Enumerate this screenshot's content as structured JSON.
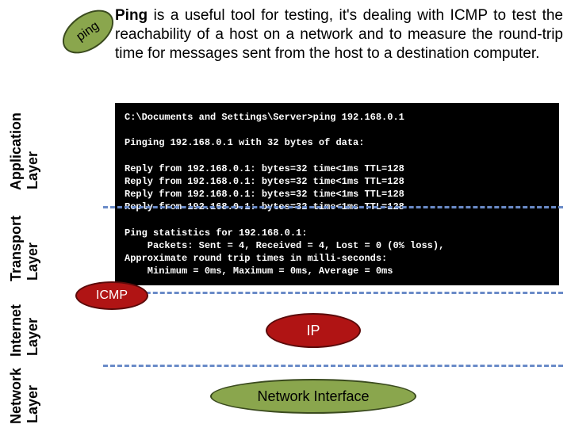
{
  "paragraph": {
    "bold": "Ping",
    "rest": " is a useful tool for testing, it's dealing with ICMP to test the reachability of a host on a network and to measure the round-trip time for messages sent from the host to a destination computer."
  },
  "badges": {
    "ping": "ping",
    "icmp": "ICMP",
    "ip": "IP",
    "netif": "Network Interface"
  },
  "layers": {
    "application": "Application",
    "transport": "Transport",
    "internet": "Internet",
    "network": "Network",
    "sub": "Layer"
  },
  "terminal": {
    "line1": "C:\\Documents and Settings\\Server>ping 192.168.0.1",
    "blank1": "",
    "line2": "Pinging 192.168.0.1 with 32 bytes of data:",
    "blank2": "",
    "r1": "Reply from 192.168.0.1: bytes=32 time<1ms TTL=128",
    "r2": "Reply from 192.168.0.1: bytes=32 time<1ms TTL=128",
    "r3": "Reply from 192.168.0.1: bytes=32 time<1ms TTL=128",
    "r4": "Reply from 192.168.0.1: bytes=32 time<1ms TTL=128",
    "blank3": "",
    "s1": "Ping statistics for 192.168.0.1:",
    "s2": "    Packets: Sent = 4, Received = 4, Lost = 0 (0% loss),",
    "s3": "Approximate round trip times in milli-seconds:",
    "s4": "    Minimum = 0ms, Maximum = 0ms, Average = 0ms"
  }
}
